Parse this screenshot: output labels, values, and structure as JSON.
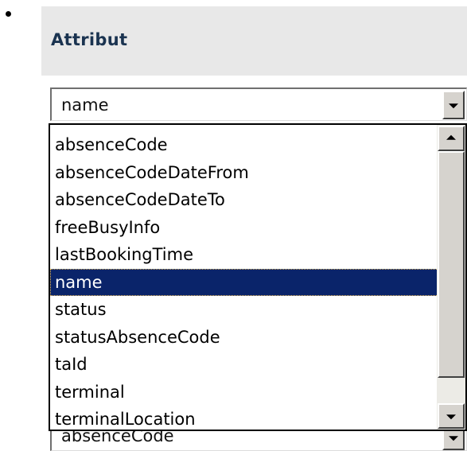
{
  "header": {
    "title": "Attribut"
  },
  "attribute_select": {
    "value": "name"
  },
  "dropdown": {
    "items": [
      {
        "label": "absenceCode"
      },
      {
        "label": "absenceCodeDateFrom"
      },
      {
        "label": "absenceCodeDateTo"
      },
      {
        "label": "freeBusyInfo"
      },
      {
        "label": "lastBookingTime"
      },
      {
        "label": "name",
        "selected": true
      },
      {
        "label": "status"
      },
      {
        "label": "statusAbsenceCode"
      },
      {
        "label": "taId"
      },
      {
        "label": "terminal"
      },
      {
        "label": "terminalLocation"
      }
    ]
  },
  "second_select": {
    "value": "absenceCode"
  },
  "colors": {
    "highlight": "#0a246a",
    "header_bg": "#e8e8e8",
    "title": "#1a3350"
  }
}
